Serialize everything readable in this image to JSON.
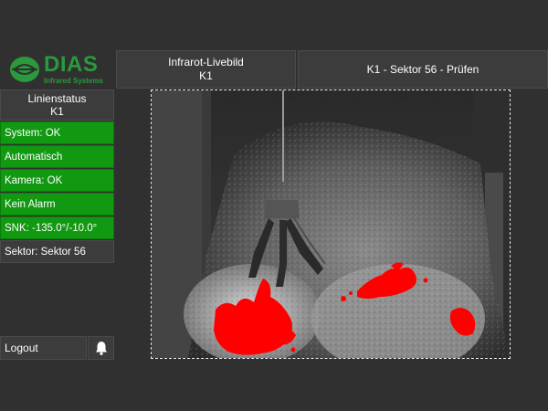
{
  "brand": {
    "name": "DIAS",
    "subtitle": "Infrared Systems",
    "color": "#2a9a3c"
  },
  "header": {
    "live": {
      "title": "Infrarot-Livebild",
      "subtitle": "K1"
    },
    "sector": {
      "title": "K1 - Sektor 56 - Prüfen"
    }
  },
  "status": {
    "title": "Linienstatus",
    "subtitle": "K1",
    "items": [
      {
        "label": "System: OK",
        "state": "ok"
      },
      {
        "label": "Automatisch",
        "state": "ok"
      },
      {
        "label": "Kamera: OK",
        "state": "ok"
      },
      {
        "label": "Kein Alarm",
        "state": "ok"
      },
      {
        "label": "SNK:  -135.0°/-10.0°",
        "state": "ok"
      },
      {
        "label": "Sektor: Sektor 56",
        "state": "neutral"
      }
    ]
  },
  "footer": {
    "logout_label": "Logout",
    "bell_icon": "bell-icon"
  },
  "colors": {
    "ok": "#119a11",
    "panel": "#3c3c3c",
    "background": "#303030",
    "hotspot": "#ff0000"
  }
}
